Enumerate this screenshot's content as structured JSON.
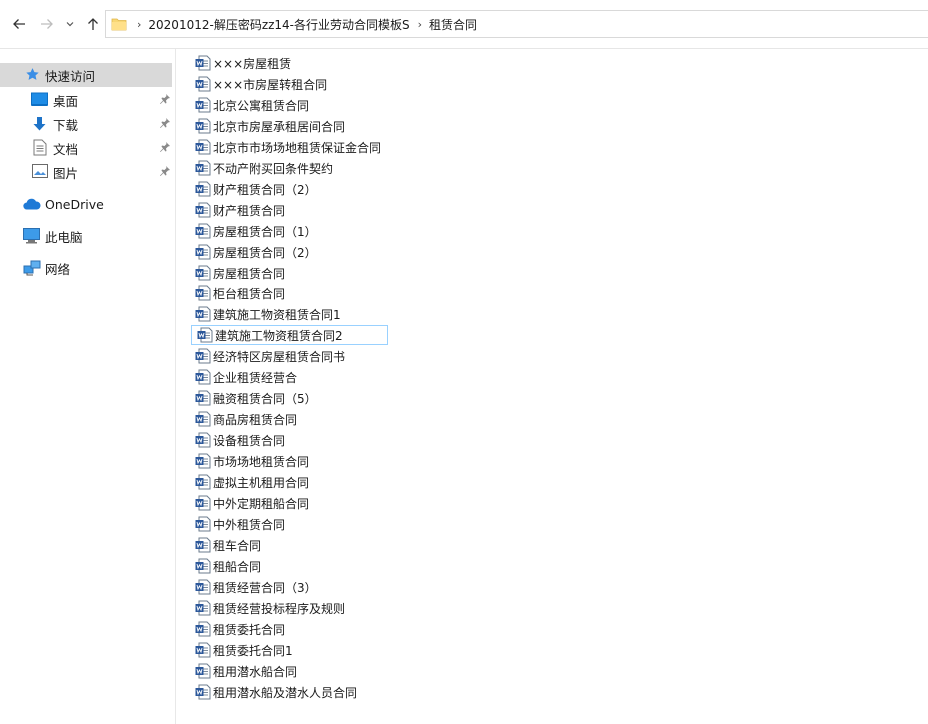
{
  "address_bar": {
    "path": [
      "20201012-解压密码zz14-各行业劳动合同模板S",
      "租赁合同"
    ]
  },
  "nav_pane": {
    "quick_access": "快速访问",
    "pinned": [
      "桌面",
      "下载",
      "文档",
      "图片"
    ],
    "onedrive": "OneDrive",
    "this_pc": "此电脑",
    "network": "网络"
  },
  "files": [
    "×××房屋租赁",
    "×××市房屋转租合同",
    "北京公寓租赁合同",
    "北京市房屋承租居间合同",
    "北京市市场场地租赁保证金合同",
    "不动产附买回条件契约",
    "财产租赁合同（2）",
    "财产租赁合同",
    "房屋租赁合同（1）",
    "房屋租赁合同（2）",
    "房屋租赁合同",
    "柜台租赁合同",
    "建筑施工物资租赁合同1",
    "建筑施工物资租赁合同2",
    "经济特区房屋租赁合同书",
    "企业租赁经营合",
    "融资租赁合同（5）",
    "商品房租赁合同",
    "设备租赁合同",
    "市场场地租赁合同",
    "虚拟主机租用合同",
    "中外定期租船合同",
    "中外租赁合同",
    "租车合同",
    "租船合同",
    "租赁经营合同（3）",
    "租赁经营投标程序及规则",
    "租赁委托合同",
    "租赁委托合同1",
    "租用潜水船合同",
    "租用潜水船及潜水人员合同"
  ],
  "focused_file_index": 13,
  "colors": {
    "selected_nav": "#d9d9d9",
    "focus_border": "#99d1ff",
    "word_icon_blue": "#2b579a"
  }
}
